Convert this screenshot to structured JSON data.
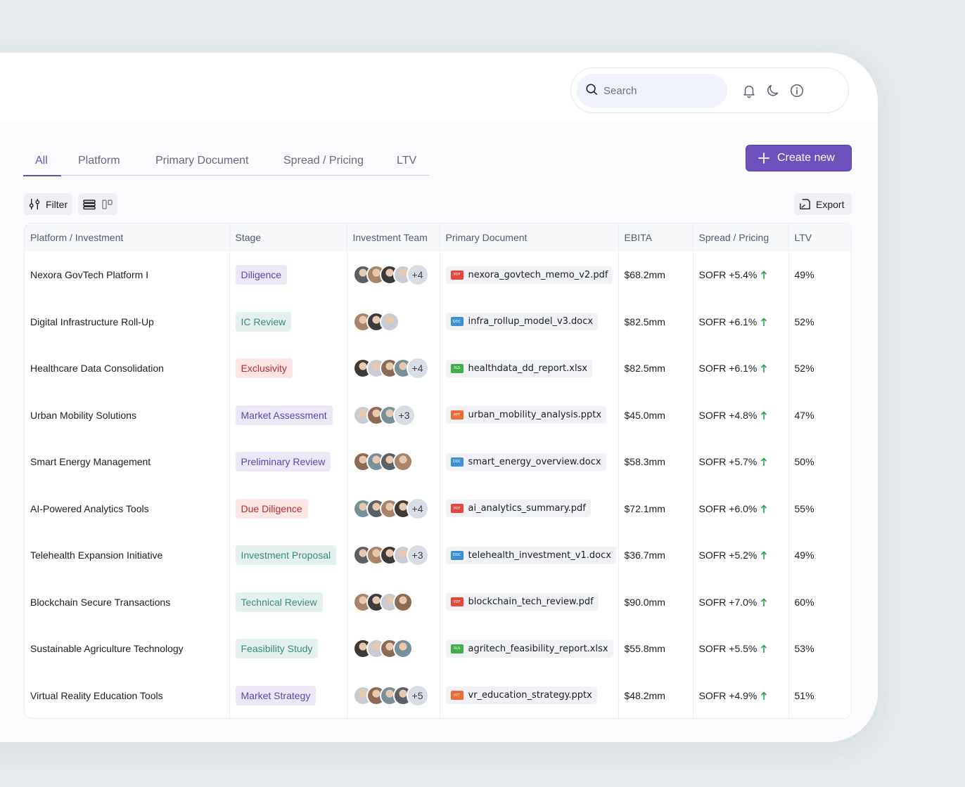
{
  "header": {
    "search_placeholder": "Search",
    "icons": [
      "bell-icon",
      "moon-icon",
      "info-icon"
    ]
  },
  "tabs": [
    "All",
    "Platform",
    "Primary Document",
    "Spread / Pricing",
    "LTV"
  ],
  "active_tab": "All",
  "create_button": "Create new",
  "toolbar": {
    "filter": "Filter",
    "export": "Export"
  },
  "table": {
    "columns": [
      "Platform / Investment",
      "Stage",
      "Investment Team",
      "Primary Document",
      "EBITA",
      "Spread / Pricing",
      "LTV"
    ],
    "rows": [
      {
        "name": "Nexora GovTech Platform I",
        "stage": "Diligence",
        "stage_color": "purple",
        "avatars": 4,
        "more": "+4",
        "doc": "nexora_govtech_memo_v2.pdf",
        "doc_type": "PDF",
        "ebita": "$68.2mm",
        "pricing": "SOFR +5.4%",
        "ltv": "49%"
      },
      {
        "name": "Digital Infrastructure Roll-Up",
        "stage": "IC Review",
        "stage_color": "teal",
        "avatars": 3,
        "more": "",
        "doc": "infra_rollup_model_v3.docx",
        "doc_type": "DOC",
        "ebita": "$82.5mm",
        "pricing": "SOFR +6.1%",
        "ltv": "52%"
      },
      {
        "name": "Healthcare Data Consolidation",
        "stage": "Exclusivity",
        "stage_color": "red",
        "avatars": 4,
        "more": "+4",
        "doc": "healthdata_dd_report.xlsx",
        "doc_type": "XLS",
        "ebita": "$82.5mm",
        "pricing": "SOFR +6.1%",
        "ltv": "52%"
      },
      {
        "name": "Urban Mobility Solutions",
        "stage": "Market Assessment",
        "stage_color": "purple",
        "avatars": 3,
        "more": "+3",
        "doc": "urban_mobility_analysis.pptx",
        "doc_type": "PPT",
        "ebita": "$45.0mm",
        "pricing": "SOFR +4.8%",
        "ltv": "47%"
      },
      {
        "name": "Smart Energy Management",
        "stage": "Preliminary Review",
        "stage_color": "purple",
        "avatars": 4,
        "more": "",
        "doc": "smart_energy_overview.docx",
        "doc_type": "DOC",
        "ebita": "$58.3mm",
        "pricing": "SOFR +5.7%",
        "ltv": "50%"
      },
      {
        "name": "AI-Powered Analytics Tools",
        "stage": "Due Diligence",
        "stage_color": "red",
        "avatars": 4,
        "more": "+4",
        "doc": "ai_analytics_summary.pdf",
        "doc_type": "PDF",
        "ebita": "$72.1mm",
        "pricing": "SOFR +6.0%",
        "ltv": "55%"
      },
      {
        "name": "Telehealth Expansion Initiative",
        "stage": "Investment Proposal",
        "stage_color": "teal",
        "avatars": 4,
        "more": "+3",
        "doc": "telehealth_investment_v1.docx",
        "doc_type": "DOC",
        "ebita": "$36.7mm",
        "pricing": "SOFR +5.2%",
        "ltv": "49%"
      },
      {
        "name": "Blockchain Secure Transactions",
        "stage": "Technical Review",
        "stage_color": "teal",
        "avatars": 4,
        "more": "",
        "doc": "blockchain_tech_review.pdf",
        "doc_type": "PDF",
        "ebita": "$90.0mm",
        "pricing": "SOFR +7.0%",
        "ltv": "60%"
      },
      {
        "name": "Sustainable Agriculture Technology",
        "stage": "Feasibility Study",
        "stage_color": "teal",
        "avatars": 4,
        "more": "",
        "doc": "agritech_feasibility_report.xlsx",
        "doc_type": "XLS",
        "ebita": "$55.8mm",
        "pricing": "SOFR +5.5%",
        "ltv": "53%"
      },
      {
        "name": "Virtual Reality Education Tools",
        "stage": "Market Strategy",
        "stage_color": "purple",
        "avatars": 4,
        "more": "+5",
        "doc": "vr_education_strategy.pptx",
        "doc_type": "PPT",
        "ebita": "$48.2mm",
        "pricing": "SOFR +4.9%",
        "ltv": "51%"
      }
    ]
  },
  "colors": {
    "accent": "#6d52be",
    "arrow_up": "#1fa84a",
    "doc_pdf": "#e5483b",
    "doc_doc": "#3d8fd6",
    "doc_xls": "#3fae4b",
    "doc_ppt": "#ef6a34"
  }
}
